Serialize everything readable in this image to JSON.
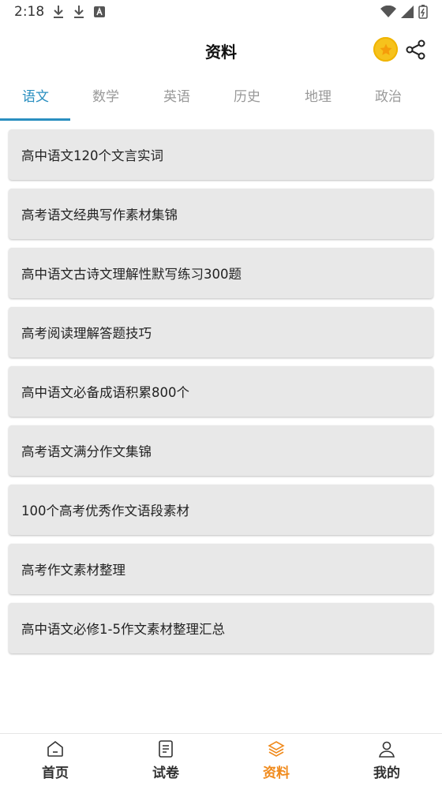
{
  "status_bar": {
    "time": "2:18"
  },
  "header": {
    "title": "资料"
  },
  "tabs": [
    {
      "label": "语文",
      "active": true
    },
    {
      "label": "数学",
      "active": false
    },
    {
      "label": "英语",
      "active": false
    },
    {
      "label": "历史",
      "active": false
    },
    {
      "label": "地理",
      "active": false
    },
    {
      "label": "政治",
      "active": false
    }
  ],
  "items": [
    "高中语文120个文言实词",
    "高考语文经典写作素材集锦",
    "高中语文古诗文理解性默写练习300题",
    "高考阅读理解答题技巧",
    "高中语文必备成语积累800个",
    "高考语文满分作文集锦",
    "100个高考优秀作文语段素材",
    "高考作文素材整理",
    "高中语文必修1-5作文素材整理汇总"
  ],
  "bottom_nav": [
    {
      "label": "首页",
      "icon": "home-icon",
      "active": false
    },
    {
      "label": "试卷",
      "icon": "paper-icon",
      "active": false
    },
    {
      "label": "资料",
      "icon": "layers-icon",
      "active": true
    },
    {
      "label": "我的",
      "icon": "user-icon",
      "active": false
    }
  ],
  "colors": {
    "accent": "#2a8fc0",
    "nav_active": "#f08a1c",
    "coin": "#f6c21c"
  }
}
